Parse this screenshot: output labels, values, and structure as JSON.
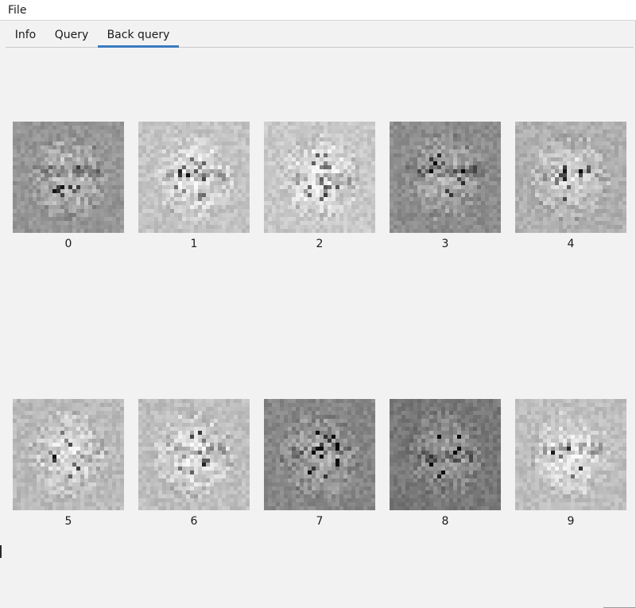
{
  "menubar": {
    "items": [
      "File"
    ]
  },
  "tabs": {
    "items": [
      "Info",
      "Query",
      "Back query"
    ],
    "active": "Back query"
  },
  "grid": {
    "labels": [
      "0",
      "1",
      "2",
      "3",
      "4",
      "5",
      "6",
      "7",
      "8",
      "9"
    ]
  }
}
